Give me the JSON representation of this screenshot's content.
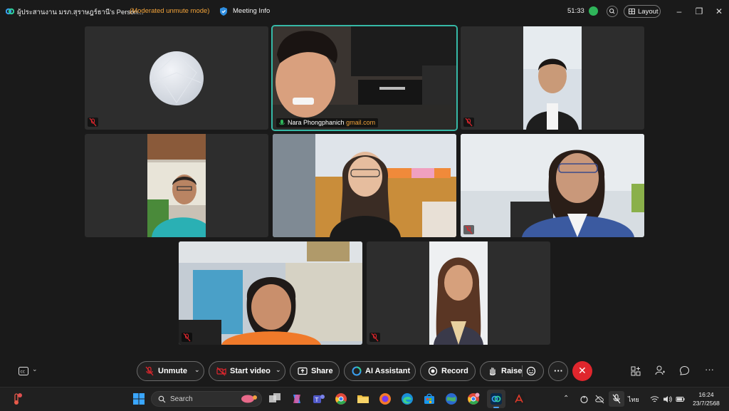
{
  "window": {
    "title": "ผู้ประสานงาน มรภ.สุราษฎร์ธานี's Person...",
    "mode": "(Moderated unmute mode)",
    "meeting_info": "Meeting Info",
    "timer": "51:33",
    "layout_label": "Layout"
  },
  "participants": [
    {
      "name": "",
      "muted": true,
      "avatar": true
    },
    {
      "name": "Nara Phongphanich",
      "email_suffix": "gmail.com",
      "muted": false,
      "active": true
    },
    {
      "name": "",
      "muted": true
    },
    {
      "name": "",
      "muted": false
    },
    {
      "name": "",
      "muted": false
    },
    {
      "name": "",
      "muted": true
    },
    {
      "name": "",
      "muted": true
    },
    {
      "name": "",
      "muted": true
    }
  ],
  "controls": {
    "unmute": "Unmute",
    "start_video": "Start video",
    "share": "Share",
    "ai_assistant": "AI Assistant",
    "record": "Record",
    "raise": "Raise"
  },
  "taskbar": {
    "search_placeholder": "Search",
    "language": "ไทย",
    "time": "16:24",
    "date": "23/7/2568"
  },
  "colors": {
    "active_border": "#36b9a7",
    "mode_text": "#f2a33a",
    "end_call": "#e0262d",
    "muted_icon": "#e0262d"
  }
}
